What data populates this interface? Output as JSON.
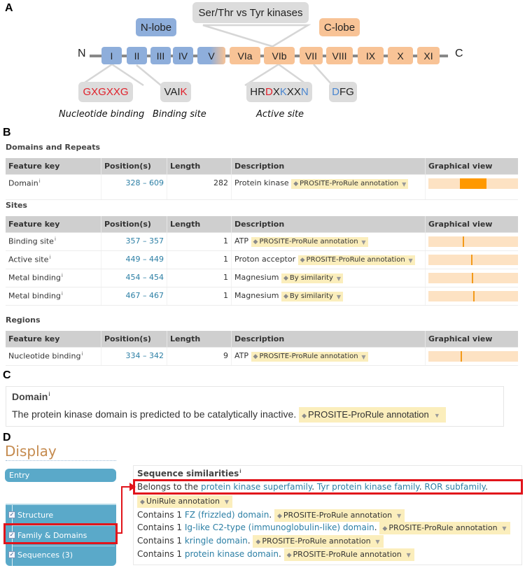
{
  "panel_labels": {
    "a": "A",
    "b": "B",
    "c": "C",
    "d": "D"
  },
  "diagram": {
    "n_terminus": "N",
    "c_terminus": "C",
    "lobes": {
      "n_lobe": "N-lobe",
      "c_lobe": "C-lobe"
    },
    "top_callout": "Ser/Thr vs Tyr kinases",
    "subdomains": [
      "I",
      "II",
      "III",
      "IV",
      "V",
      "VIa",
      "VIb",
      "VII",
      "VIII",
      "IX",
      "X",
      "XI"
    ],
    "motifs": {
      "gxgxxg": "GXGXXG",
      "vaik_plain": "VAI",
      "vaik_red": "K",
      "hrd": [
        {
          "text": "HR",
          "color": "black"
        },
        {
          "text": "D",
          "color": "red"
        },
        {
          "text": "X",
          "color": "black"
        },
        {
          "text": "K",
          "color": "blue"
        },
        {
          "text": "XX",
          "color": "black"
        },
        {
          "text": "N",
          "color": "blue"
        }
      ],
      "dfg_blue": "D",
      "dfg_plain": "FG"
    },
    "captions": {
      "nucleotide": "Nucleotide binding",
      "binding": "Binding site",
      "active": "Active site"
    },
    "colors": {
      "n_lobe": "#8eaedb",
      "c_lobe": "#f8c396",
      "callout": "#dcdcdc",
      "red": "#e0202a",
      "blue": "#4a86d0"
    }
  },
  "features": {
    "columns": [
      "Feature key",
      "Position(s)",
      "Length",
      "Description",
      "Graphical view"
    ],
    "sequence_length": 937,
    "sections": [
      {
        "title": "Domains and Repeats",
        "rows": [
          {
            "key": "Domain",
            "pos": "328 – 609",
            "start": 328,
            "end": 609,
            "length": "282",
            "desc": "Protein kinase",
            "evidence": "PROSITE-ProRule annotation"
          }
        ]
      },
      {
        "title": "Sites",
        "rows": [
          {
            "key": "Binding site",
            "pos": "357 – 357",
            "start": 357,
            "end": 357,
            "length": "1",
            "desc": "ATP",
            "evidence": "PROSITE-ProRule annotation"
          },
          {
            "key": "Active site",
            "pos": "449 – 449",
            "start": 449,
            "end": 449,
            "length": "1",
            "desc": "Proton acceptor",
            "evidence": "PROSITE-ProRule annotation"
          },
          {
            "key": "Metal binding",
            "pos": "454 – 454",
            "start": 454,
            "end": 454,
            "length": "1",
            "desc": "Magnesium",
            "evidence": "By similarity"
          },
          {
            "key": "Metal binding",
            "pos": "467 – 467",
            "start": 467,
            "end": 467,
            "length": "1",
            "desc": "Magnesium",
            "evidence": "By similarity"
          }
        ]
      },
      {
        "title": "Regions",
        "rows": [
          {
            "key": "Nucleotide binding",
            "pos": "334 – 342",
            "start": 334,
            "end": 342,
            "length": "9",
            "desc": "ATP",
            "evidence": "PROSITE-ProRule annotation"
          }
        ]
      }
    ],
    "info_sup": "i"
  },
  "domain_note": {
    "title": "Domain",
    "sup": "i",
    "text": "The protein kinase domain is predicted to be catalytically inactive.",
    "evidence": "PROSITE-ProRule annotation"
  },
  "display_nav": {
    "title": "Display",
    "entry": "Entry",
    "items": [
      {
        "label": "Structure",
        "checked": true
      },
      {
        "label": "Family & Domains",
        "checked": true
      },
      {
        "label": "Sequences (3)",
        "checked": true
      }
    ]
  },
  "sequence_similarities": {
    "title": "Sequence similarities",
    "sup": "i",
    "belongs_prefix": "Belongs to the ",
    "belongs_links": [
      "protein kinase superfamily",
      "Tyr protein kinase family",
      "ROR subfamily"
    ],
    "belongs_evidence": "UniRule annotation",
    "contains": [
      {
        "prefix": "Contains 1 ",
        "link": "FZ (frizzled) domain",
        "evidence": "PROSITE-ProRule annotation"
      },
      {
        "prefix": "Contains 1 ",
        "link": "Ig-like C2-type (immunoglobulin-like) domain",
        "evidence": "PROSITE-ProRule annotation"
      },
      {
        "prefix": "Contains 1 ",
        "link": "kringle domain",
        "evidence": "PROSITE-ProRule annotation"
      },
      {
        "prefix": "Contains 1 ",
        "link": "protein kinase domain",
        "evidence": "PROSITE-ProRule annotation"
      }
    ]
  },
  "icons": {
    "evidence_tag": "tag-icon",
    "dropdown": "caret-down-icon",
    "checkbox": "checkbox-icon",
    "arrow": "red-arrow-icon"
  }
}
